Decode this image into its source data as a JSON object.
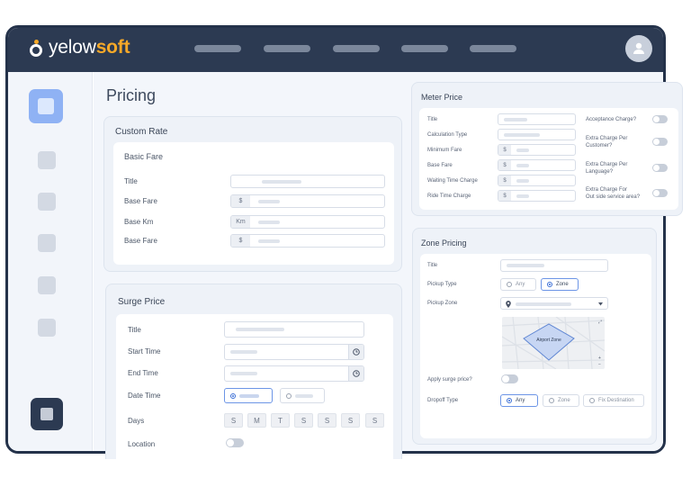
{
  "brand": {
    "part1": "yelow",
    "part2": "soft"
  },
  "page_title": "Pricing",
  "custom_rate": {
    "title": "Custom Rate",
    "basic_fare": {
      "title": "Basic Fare",
      "fields": [
        {
          "label": "Title",
          "addon": ""
        },
        {
          "label": "Base Fare",
          "addon": "$"
        },
        {
          "label": "Base Km",
          "addon": "Km"
        },
        {
          "label": "Base Fare",
          "addon": "$"
        }
      ]
    }
  },
  "surge_price": {
    "title": "Surge Price",
    "labels": {
      "title": "Title",
      "start_time": "Start Time",
      "end_time": "End Time",
      "date_time": "Date Time",
      "days": "Days",
      "location": "Location"
    },
    "days": [
      "S",
      "M",
      "T",
      "S",
      "S",
      "S",
      "S"
    ]
  },
  "meter_price": {
    "title": "Meter Price",
    "fields": [
      {
        "label": "Title",
        "addon": ""
      },
      {
        "label": "Calculation Type",
        "addon": ""
      },
      {
        "label": "Minimum Fare",
        "addon": "$"
      },
      {
        "label": "Base Fare",
        "addon": "$"
      },
      {
        "label": "Waiting Time Charge",
        "addon": "$"
      },
      {
        "label": "Ride Time Charge",
        "addon": "$"
      }
    ],
    "toggles": [
      "Acceptance Charge?",
      "Extra Charge Per\nCustomer?",
      "Extra Charge Per\nLanguage?",
      "Extra Charge For\nOut side service area?"
    ]
  },
  "zone_pricing": {
    "title": "Zone Pricing",
    "labels": {
      "title": "Title",
      "pickup_type": "Pickup Type",
      "pickup_zone": "Pickup Zone",
      "apply_surge": "Apply surge price?",
      "dropoff_type": "Dropoff Type"
    },
    "pickup_options": [
      "Any",
      "Zone"
    ],
    "pickup_selected": "Zone",
    "map_label": "Airport Zone",
    "dropoff_options": [
      "Any",
      "Zone",
      "Fix Destination"
    ],
    "dropoff_selected": "Any"
  },
  "colors": {
    "topbar": "#2c3a52",
    "accent": "#f7a928",
    "active": "#8fb2f4"
  }
}
